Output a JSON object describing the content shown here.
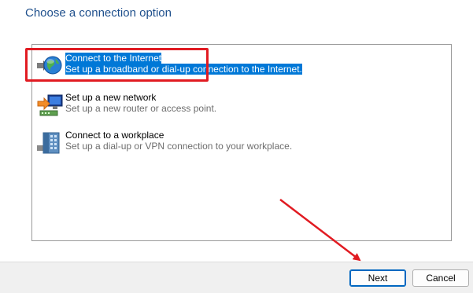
{
  "heading": "Choose a connection option",
  "options": [
    {
      "title": "Connect to the Internet",
      "description": "Set up a broadband or dial-up connection to the Internet.",
      "icon": "globe-network-icon",
      "selected": true
    },
    {
      "title": "Set up a new network",
      "description": "Set up a new router or access point.",
      "icon": "router-setup-icon",
      "selected": false
    },
    {
      "title": "Connect to a workplace",
      "description": "Set up a dial-up or VPN connection to your workplace.",
      "icon": "workplace-building-icon",
      "selected": false
    }
  ],
  "buttons": {
    "next": "Next",
    "cancel": "Cancel"
  },
  "colors": {
    "heading": "#1e4f8c",
    "selection": "#0078d7",
    "annotation": "#e11b22"
  }
}
